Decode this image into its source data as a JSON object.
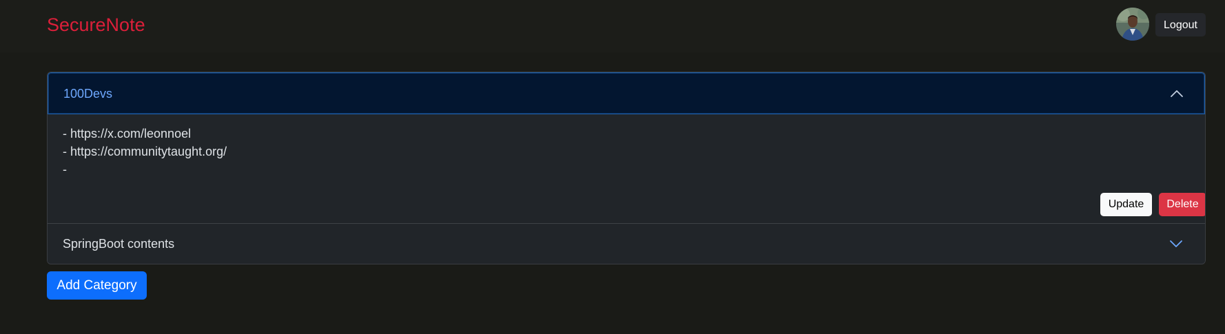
{
  "app": {
    "brand": "SecureNote"
  },
  "header": {
    "avatar_icon": "user-avatar",
    "logout_label": "Logout"
  },
  "categories": [
    {
      "title": "100Devs",
      "expanded": true,
      "notes": [
        "- https://x.com/leonnoel",
        "- https://communitytaught.org/",
        "-"
      ],
      "update_label": "Update",
      "delete_label": "Delete"
    },
    {
      "title": "SpringBoot contents",
      "expanded": false
    }
  ],
  "actions": {
    "add_category_label": "Add Category"
  },
  "colors": {
    "brand": "#dc1f3a",
    "accent": "#0d6efd",
    "danger": "#dc3545",
    "active_header_text": "#6ea8fe",
    "background": "#1a1b17"
  }
}
